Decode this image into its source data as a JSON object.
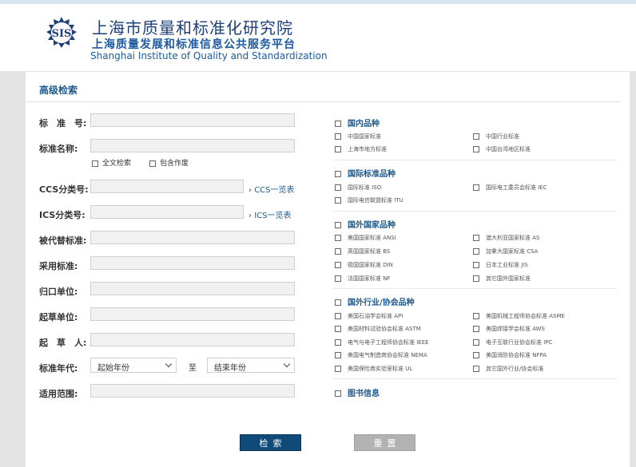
{
  "header": {
    "logo_text": "SIS",
    "title_cn": "上海市质量和标准化研究院",
    "subtitle_cn": "上海质量发展和标准信息公共服务平台",
    "title_en": "Shanghai Institute of Quality and Standardization"
  },
  "panel": {
    "title": "高级检索"
  },
  "form": {
    "std_no_label": "标　准　号:",
    "std_name_label": "标准名称:",
    "fulltext_label": "全文检索",
    "include_void_label": "包含作废",
    "ccs_label": "CCS分类号:",
    "ccs_link": "CCS一览表",
    "ics_label": "ICS分类号:",
    "ics_link": "ICS一览表",
    "replaced_label": "被代替标准:",
    "adopted_label": "采用标准:",
    "dept_label": "归口单位:",
    "drafter_unit_label": "起草单位:",
    "drafter_label": "起　草　人:",
    "year_label": "标准年代:",
    "start_year": "起始年份",
    "to_label": "至",
    "end_year": "结束年份",
    "scope_label": "适用范围:"
  },
  "categories": {
    "domestic": {
      "title": "国内品种",
      "items": [
        "中国国家标准",
        "中国行业标准",
        "上海市地方标准",
        "中国台湾地区标准"
      ]
    },
    "international": {
      "title": "国际标准品种",
      "items": [
        "国际标准 ISO",
        "国际电工委员会标准 IEC",
        "国际电信联盟标准 ITU"
      ]
    },
    "foreign": {
      "title": "国外国家品种",
      "items": [
        "美国国家标准 ANSI",
        "澳大利亚国家标准 AS",
        "英国国家标准 BS",
        "加拿大国家标准 CSA",
        "德国国家标准 DIN",
        "日本工业标准 JIS",
        "法国国家标准 NF",
        "其它国外国家标准"
      ]
    },
    "industry": {
      "title": "国外行业/协会品种",
      "items": [
        "美国石油学会标准 API",
        "美国机械工程师协会标准 ASME",
        "美国材料试验协会标准 ASTM",
        "美国焊接学会标准 AWS",
        "电气与电子工程师协会标准 IEEE",
        "电子互联行业协会标准 IPC",
        "美国电气制造商协会标准 NEMA",
        "美国消防协会标准 NFPA",
        "美国保险商实验室标准 UL",
        "其它国外行业/协会标准"
      ]
    },
    "books": {
      "title": "图书信息"
    }
  },
  "buttons": {
    "search": "检索",
    "reset": "重置"
  },
  "colors": {
    "accent": "#1d5a8e",
    "primary_button": "#0f4a78",
    "reset_button": "#b2b2b2"
  }
}
